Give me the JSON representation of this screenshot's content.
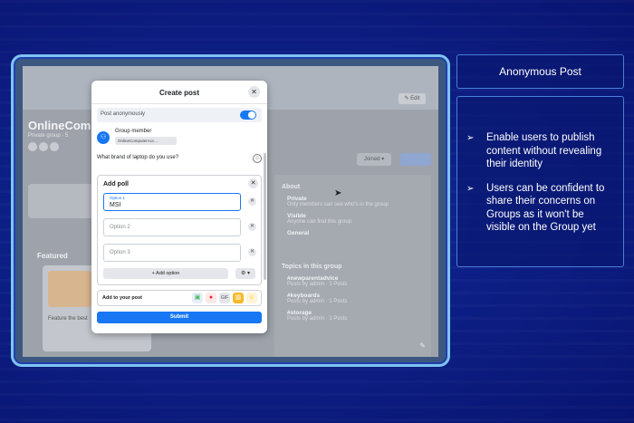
{
  "slide": {
    "title": "Anonymous Post",
    "bullets": [
      "Enable users to publish content without revealing their identity",
      "Users can be confident to share their concerns on Groups as it won't be visible on the Group yet"
    ],
    "bullet_marker": "➢"
  },
  "background_page": {
    "group_name": "OnlineComp",
    "group_sub": "Private group · 5",
    "edit_label": "✎ Edit",
    "joined_label": "Joined ▾",
    "featured_label": "Featured",
    "featured_card_text": "Feature the best",
    "about_label": "About",
    "about_rows": [
      {
        "title": "Private",
        "text": "Only members can see who's in the group"
      },
      {
        "title": "Visible",
        "text": "Anyone can find this group"
      },
      {
        "title": "General",
        "text": ""
      }
    ],
    "topics_label": "Topics in this group",
    "topics": [
      {
        "title": "#newparentadvice",
        "text": "Posts by admin · 1 Posts"
      },
      {
        "title": "#keyboards",
        "text": "Posts by admin · 1 Posts"
      },
      {
        "title": "#storage",
        "text": "Posts by admin · 1 Posts"
      }
    ]
  },
  "dialog": {
    "title": "Create post",
    "close_glyph": "✕",
    "anon_label": "Post anonymously",
    "anon_on": true,
    "member_label": "Group member",
    "member_chip": "OnlineComputerAcc...",
    "question": "What brand of laptop do you use?",
    "poll_title": "Add poll",
    "options": [
      {
        "caption": "Option 1",
        "value": "MSI",
        "placeholder": ""
      },
      {
        "caption": "",
        "value": "",
        "placeholder": "Option 2"
      },
      {
        "caption": "",
        "value": "",
        "placeholder": "Option 3"
      }
    ],
    "add_option_label": "+ Add option",
    "gear_label": "⚙ ▾",
    "add_to_post_label": "Add to your post",
    "submit_label": "Submit"
  },
  "colors": {
    "accent": "#1877f2",
    "slide_bg": "#0d1f86",
    "frame_border": "#7fc4f0"
  }
}
